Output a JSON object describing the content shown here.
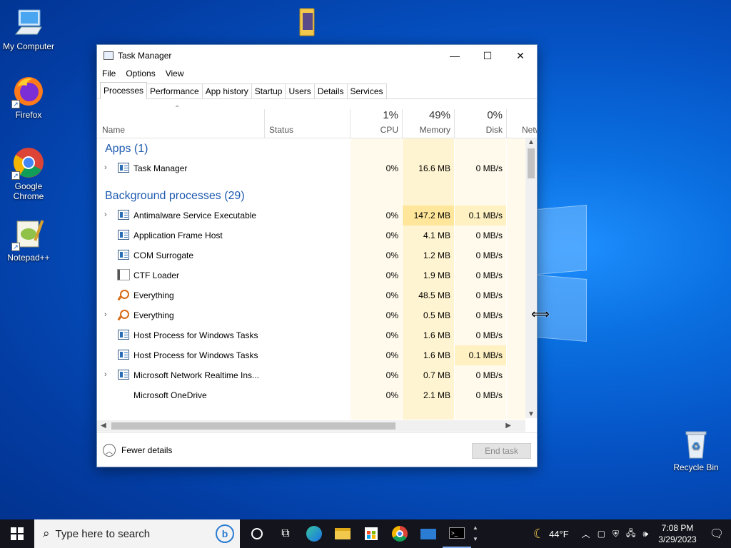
{
  "desktop": {
    "icons": [
      {
        "label": "My Computer",
        "icon": "computer-icon"
      },
      {
        "label": "Firefox",
        "icon": "firefox-icon"
      },
      {
        "label": "Google Chrome",
        "icon": "chrome-icon"
      },
      {
        "label": "Notepad++",
        "icon": "notepadpp-icon"
      },
      {
        "label": "",
        "icon": "folder-icon"
      },
      {
        "label": "Recycle Bin",
        "icon": "recycle-bin-icon"
      }
    ]
  },
  "window": {
    "title": "Task Manager",
    "controls": {
      "minimize": "—",
      "maximize": "☐",
      "close": "✕"
    },
    "menu": [
      "File",
      "Options",
      "View"
    ],
    "tabs": [
      "Processes",
      "Performance",
      "App history",
      "Startup",
      "Users",
      "Details",
      "Services"
    ],
    "active_tab": "Processes",
    "columns": {
      "name": "Name",
      "status": "Status",
      "cpu": {
        "label": "CPU",
        "pct": "1%"
      },
      "memory": {
        "label": "Memory",
        "pct": "49%"
      },
      "disk": {
        "label": "Disk",
        "pct": "0%"
      },
      "network": {
        "label": "Netw"
      }
    },
    "groups": {
      "apps": "Apps (1)",
      "background": "Background processes (29)"
    },
    "apps": [
      {
        "name": "Task Manager",
        "cpu": "0%",
        "memory": "16.6 MB",
        "disk": "0 MB/s",
        "expandable": true,
        "icon": "task-manager-icon"
      }
    ],
    "background": [
      {
        "name": "Antimalware Service Executable",
        "cpu": "0%",
        "memory": "147.2 MB",
        "disk": "0.1 MB/s",
        "expandable": true,
        "icon": "process-icon"
      },
      {
        "name": "Application Frame Host",
        "cpu": "0%",
        "memory": "4.1 MB",
        "disk": "0 MB/s",
        "expandable": false,
        "icon": "process-icon"
      },
      {
        "name": "COM Surrogate",
        "cpu": "0%",
        "memory": "1.2 MB",
        "disk": "0 MB/s",
        "expandable": false,
        "icon": "process-icon"
      },
      {
        "name": "CTF Loader",
        "cpu": "0%",
        "memory": "1.9 MB",
        "disk": "0 MB/s",
        "expandable": false,
        "icon": "ctf-loader-icon"
      },
      {
        "name": "Everything",
        "cpu": "0%",
        "memory": "48.5 MB",
        "disk": "0 MB/s",
        "expandable": false,
        "icon": "everything-icon"
      },
      {
        "name": "Everything",
        "cpu": "0%",
        "memory": "0.5 MB",
        "disk": "0 MB/s",
        "expandable": true,
        "icon": "everything-icon"
      },
      {
        "name": "Host Process for Windows Tasks",
        "cpu": "0%",
        "memory": "1.6 MB",
        "disk": "0 MB/s",
        "expandable": false,
        "icon": "process-icon"
      },
      {
        "name": "Host Process for Windows Tasks",
        "cpu": "0%",
        "memory": "1.6 MB",
        "disk": "0.1 MB/s",
        "expandable": false,
        "icon": "process-icon"
      },
      {
        "name": "Microsoft Network Realtime Ins...",
        "cpu": "0%",
        "memory": "0.7 MB",
        "disk": "0 MB/s",
        "expandable": true,
        "icon": "process-icon"
      },
      {
        "name": "Microsoft OneDrive",
        "cpu": "0%",
        "memory": "2.1 MB",
        "disk": "0 MB/s",
        "expandable": false,
        "icon": "onedrive-icon"
      }
    ],
    "footer": {
      "fewer_details": "Fewer details",
      "end_task": "End task"
    }
  },
  "taskbar": {
    "search_placeholder": "Type here to search",
    "weather": "44°F",
    "time": "7:08 PM",
    "date": "3/29/2023"
  },
  "colors": {
    "heat_light": "#fff8e1",
    "heat_mid": "#fff1c2",
    "heat_strong": "#ffe69a",
    "accent": "#1f5bb0"
  }
}
